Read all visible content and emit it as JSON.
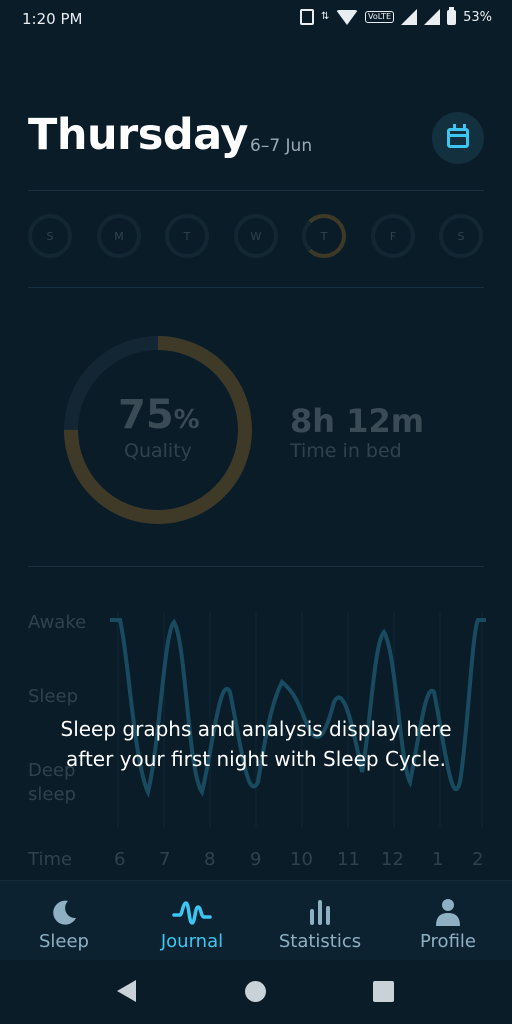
{
  "status_bar": {
    "time": "1:20 PM",
    "battery": "53%"
  },
  "header": {
    "day": "Thursday",
    "date_range": "6–7 Jun"
  },
  "week": [
    "S",
    "M",
    "T",
    "W",
    "T",
    "F",
    "S"
  ],
  "summary": {
    "quality_value": "75",
    "quality_unit": "%",
    "quality_label": "Quality",
    "time_in_bed_value": "8h 12m",
    "time_in_bed_label": "Time in bed"
  },
  "graph": {
    "y_labels": [
      "Awake",
      "Sleep",
      "Deep",
      "sleep"
    ],
    "time_label": "Time",
    "hours": [
      "6",
      "7",
      "8",
      "9",
      "10",
      "11",
      "12",
      "1",
      "2"
    ]
  },
  "overlay_message": "Sleep graphs and analysis display here after your first night with Sleep Cycle.",
  "nav": [
    {
      "label": "Sleep"
    },
    {
      "label": "Journal"
    },
    {
      "label": "Statistics"
    },
    {
      "label": "Profile"
    }
  ],
  "colors": {
    "accent": "#3ec6f2",
    "background": "#0a1c28",
    "quality_ring": "#c88a2a"
  }
}
